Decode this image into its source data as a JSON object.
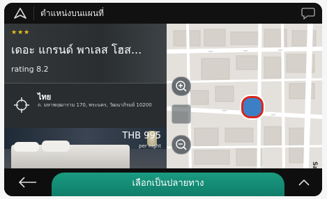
{
  "topbar": {
    "title": "ตำแหน่งบนแผนที่",
    "back_icon": "navigation-arrow-icon",
    "message_icon": "chat-bubble-icon"
  },
  "hotel": {
    "stars": "★★★",
    "name": "เดอะ แกรนด์ พาเลส โฮส...",
    "rating": "rating 8.2",
    "country": "ไทย",
    "address": "ถ. มหาพฤฒาราม 170, พระนคร, วัฒนาภิรมย์ 10200",
    "price": "THB 995",
    "price_unit": "per night"
  },
  "map": {
    "labels": [
      "Sam"
    ]
  },
  "bottombar": {
    "select_label": "เลือกเป็นปลายทาง"
  },
  "colors": {
    "accent": "#1a9b82",
    "location": "#3d7fc4",
    "location_ring": "#d9261c",
    "stars": "#f0c419"
  }
}
